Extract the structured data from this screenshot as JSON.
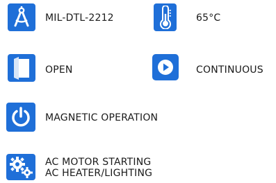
{
  "colors": {
    "icon_bg": "#1f6fd8",
    "icon_fg": "#ffffff"
  },
  "specs": [
    {
      "icon": "compass-icon",
      "label": "MIL-DTL-2212"
    },
    {
      "icon": "thermometer-icon",
      "label": "65°C"
    },
    {
      "icon": "open-box-icon",
      "label": "OPEN"
    },
    {
      "icon": "play-icon",
      "label": "CONTINUOUS"
    },
    {
      "icon": "power-icon",
      "label": "MAGNETIC OPERATION"
    },
    {
      "icon": "gears-icon",
      "label_line1": "AC MOTOR STARTING",
      "label_line2": "AC HEATER/LIGHTING"
    }
  ]
}
